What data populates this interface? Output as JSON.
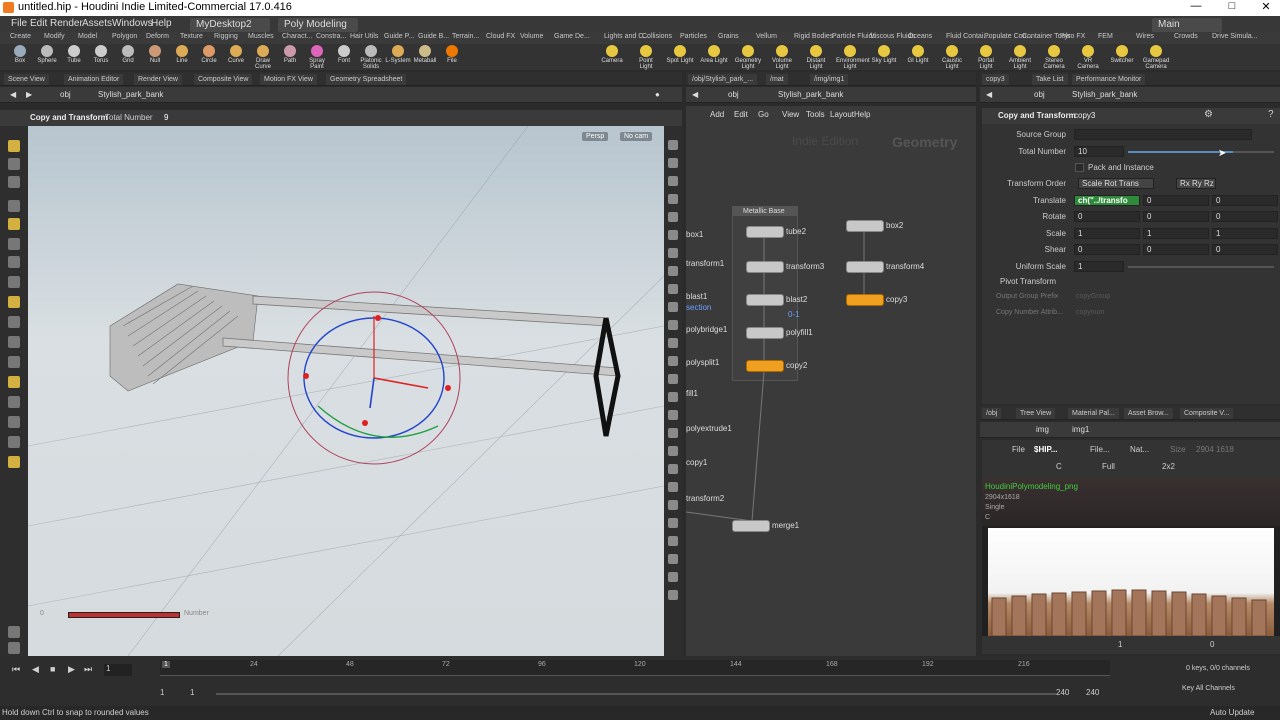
{
  "window": {
    "title": "untitled.hip - Houdini Indie Limited-Commercial 17.0.416"
  },
  "menu": {
    "items": [
      "File",
      "Edit",
      "Render",
      "Assets",
      "Windows",
      "Help"
    ],
    "desktop": "MyDesktop2",
    "desktop2": "Poly Modeling",
    "main": "Main"
  },
  "shelf_tabs_left": [
    "Create",
    "Modify",
    "Model",
    "Polygon",
    "Deform",
    "Texture",
    "Rigging",
    "Muscles",
    "Charact...",
    "Constra...",
    "Hair Utils",
    "Guide P...",
    "Guide B...",
    "Terrain...",
    "Cloud FX",
    "Volume",
    "Game De..."
  ],
  "shelf_tabs_right": [
    "Lights and C...",
    "Collisions",
    "Particles",
    "Grains",
    "Vellum",
    "Rigid Bodies",
    "Particle Fluids",
    "Viscous Fluids",
    "Oceans",
    "Fluid Contai...",
    "Populate Con...",
    "Container Tools",
    "Pyro FX",
    "FEM",
    "Wires",
    "Crowds",
    "Drive Simula..."
  ],
  "tools_left": [
    "Box",
    "Sphere",
    "Tube",
    "Torus",
    "Grid",
    "Null",
    "Line",
    "Circle",
    "Curve",
    "Draw Curve",
    "Path",
    "Spray Paint",
    "Font",
    "Platonic Solids",
    "L-System",
    "Metaball",
    "File"
  ],
  "tools_right": [
    "Camera",
    "Point Light",
    "Spot Light",
    "Area Light",
    "Geometry Light",
    "Volume Light",
    "Distant Light",
    "Environment Light",
    "Sky Light",
    "GI Light",
    "Caustic Light",
    "Portal Light",
    "Ambient Light",
    "Stereo Camera",
    "VR Camera",
    "Switcher",
    "Gamepad Camera"
  ],
  "left_tabs": [
    "Scene View",
    "Animation Editor",
    "Render View",
    "Composite View",
    "Motion FX View",
    "Geometry Spreadsheet"
  ],
  "mid_tabs": [
    "/obj/Stylish_park_...",
    "/mat",
    "/img/img1"
  ],
  "right_tabs": [
    "copy3",
    "Take List",
    "Performance Monitor"
  ],
  "path": {
    "obj": "obj",
    "node": "Stylish_park_bank"
  },
  "viewport": {
    "op": "Copy and Transform",
    "label": "Total Number",
    "value": "9",
    "persp": "Persp",
    "cam": "No cam"
  },
  "network": {
    "menu": [
      "Add",
      "Edit",
      "Go",
      "View",
      "Tools",
      "Layout",
      "Help"
    ],
    "edition": "Indie Edition",
    "context": "Geometry",
    "box_label": "Metallic Base",
    "nodes": [
      "tube2",
      "transform3",
      "blast2",
      "polyfill1",
      "copy2",
      "box2",
      "transform4",
      "copy3",
      "merge1"
    ],
    "cut_labels": [
      "box1",
      "transform1",
      "blast1",
      "polybridge1",
      "polysplit1",
      "fill1",
      "polyextrude1",
      "copy1",
      "transform2"
    ],
    "sel": "0-1",
    "sel2": "section"
  },
  "parms": {
    "op": "Copy and Transform",
    "name": "copy3",
    "source_group": "Source Group",
    "total_number_label": "Total Number",
    "total_number": "10",
    "pack": "Pack and Instance",
    "order_label": "Transform Order",
    "order": "Scale Rot Trans",
    "rot_order": "Rx Ry Rz",
    "translate_label": "Translate",
    "translate": [
      "ch(\"../transfo",
      "0",
      "0"
    ],
    "rotate_label": "Rotate",
    "rotate": [
      "0",
      "0",
      "0"
    ],
    "scale_label": "Scale",
    "scale": [
      "1",
      "1",
      "1"
    ],
    "shear_label": "Shear",
    "shear": [
      "0",
      "0",
      "0"
    ],
    "uniform_label": "Uniform Scale",
    "uniform": "1",
    "pivot": "Pivot Transform",
    "ogp": "Output Group Prefix",
    "ogp_val": "copyGroup",
    "cna": "Copy Number Attrib...",
    "cna_val": "copynum",
    "tracker_fill": 0.72
  },
  "img_tabs": [
    "/obj",
    "Tree View",
    "Material Pal...",
    "Asset Brow...",
    "Composite V..."
  ],
  "img_path": {
    "a": "img",
    "b": "img1"
  },
  "img": {
    "file": "File",
    "hip": "$HIP...",
    "file2": "File...",
    "nat": "Nat...",
    "size": "Size",
    "dims": "2904  1618",
    "c": "C",
    "full": "Full",
    "zoom": "2x2",
    "name": "HoudiniPolymodeling_png",
    "res": "2904x1618",
    "single": "Single",
    "ch": "C",
    "frame": "1",
    "frame2": "0"
  },
  "timeline": {
    "ticks": [
      "24",
      "48",
      "72",
      "96",
      "120",
      "144",
      "168",
      "192",
      "216"
    ],
    "start": "1",
    "end": "240",
    "end2": "240",
    "cur": "1",
    "cur2": "1",
    "frame_field": "1",
    "keys": "0 keys, 0/0 channels",
    "key_all": "Key All Channels"
  },
  "status": {
    "msg": "Hold down Ctrl to snap to rounded values",
    "update": "Auto Update"
  },
  "hud": {
    "number": "Number",
    "zero": "0"
  }
}
